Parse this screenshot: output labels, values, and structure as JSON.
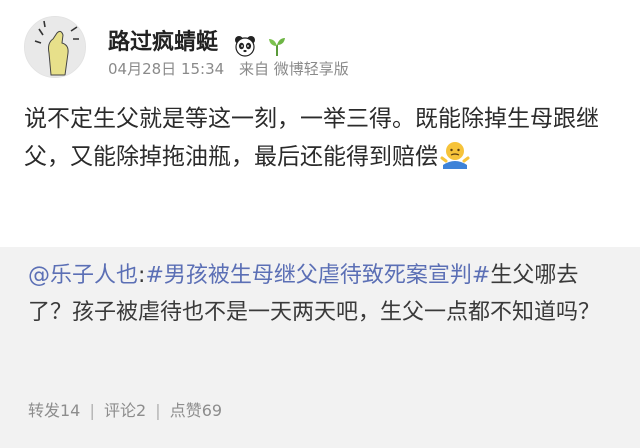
{
  "post": {
    "username": "路过疯蜻蜓",
    "badges": [
      "panda-icon",
      "sprout-icon"
    ],
    "date": "04月28日 15:34",
    "source": "来自 微博轻享版",
    "text": "说不定生父就是等这一刻，一举三得。既能除掉生母跟继父，又能除掉拖油瓶，最后还能得到赔偿",
    "emoji": "shrug-emoji-icon"
  },
  "repost": {
    "author": "@乐子人也",
    "colon": ":",
    "hashtag": "#男孩被生母继父虐待致死案宣判#",
    "text": "生父哪去了？孩子被虐待也不是一天两天吧，生父一点都不知道吗？",
    "stats": {
      "reposts": "转发14",
      "comments": "评论2",
      "likes": "点赞69",
      "separator": "|"
    }
  },
  "colors": {
    "link": "#5b6fb5",
    "repost_bg": "#f2f2f2",
    "meta": "#8a8a8a"
  }
}
